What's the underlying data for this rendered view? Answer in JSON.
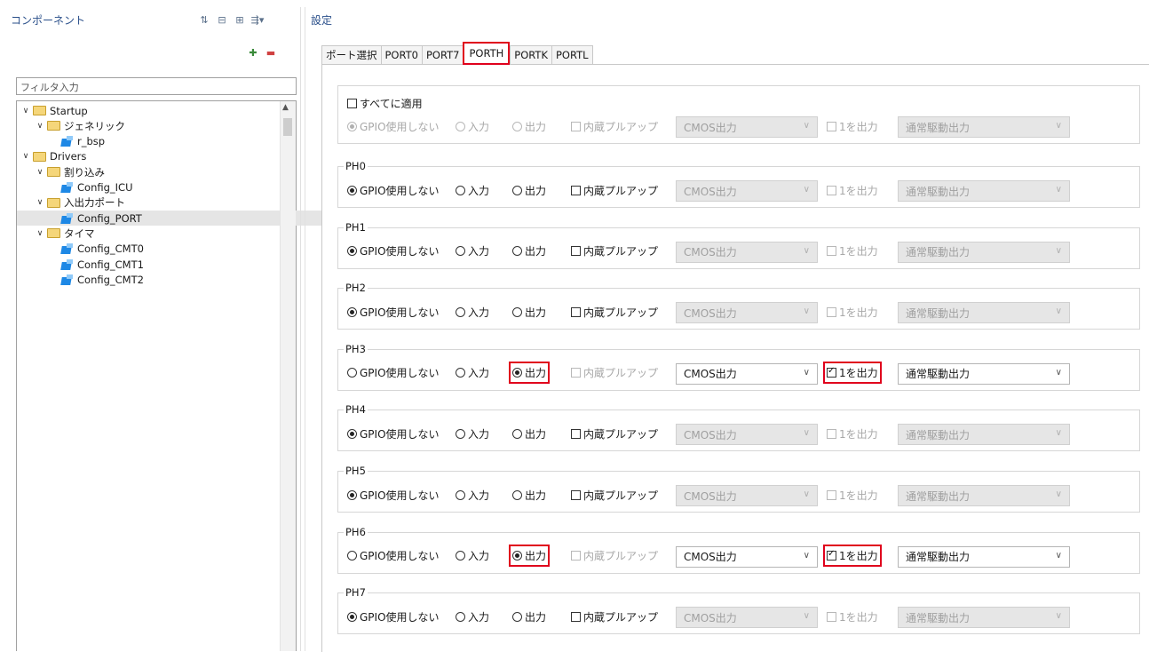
{
  "left_panel": {
    "title": "コンポーネント",
    "filter_placeholder": "フィルタ入力",
    "tree": [
      {
        "label": "Startup",
        "kind": "folder",
        "level": 0
      },
      {
        "label": "ジェネリック",
        "kind": "folder",
        "level": 1
      },
      {
        "label": "r_bsp",
        "kind": "component",
        "level": 2
      },
      {
        "label": "Drivers",
        "kind": "folder",
        "level": 0
      },
      {
        "label": "割り込み",
        "kind": "folder",
        "level": 1
      },
      {
        "label": "Config_ICU",
        "kind": "component",
        "level": 2
      },
      {
        "label": "入出力ポート",
        "kind": "folder",
        "level": 1
      },
      {
        "label": "Config_PORT",
        "kind": "component",
        "level": 2,
        "selected": true
      },
      {
        "label": "タイマ",
        "kind": "folder",
        "level": 1
      },
      {
        "label": "Config_CMT0",
        "kind": "component",
        "level": 2
      },
      {
        "label": "Config_CMT1",
        "kind": "component",
        "level": 2
      },
      {
        "label": "Config_CMT2",
        "kind": "component",
        "level": 2
      }
    ],
    "icons": [
      "sort-az-icon",
      "collapse-all-icon",
      "expand-all-icon",
      "view-menu-icon",
      "add-component-icon",
      "remove-component-icon"
    ]
  },
  "settings": {
    "title": "設定",
    "tabs": [
      "ポート選択",
      "PORT0",
      "PORT7",
      "PORTH",
      "PORTK",
      "PORTL"
    ],
    "active_tab": "PORTH",
    "apply_all": {
      "label": "すべてに適用",
      "checked": false,
      "gpio_label": "GPIO使用しない",
      "input_label": "入力",
      "output_label": "出力",
      "pullup_label": "内蔵プルアップ",
      "cmos_value": "CMOS出力",
      "out1_label": "1を出力",
      "drive_value": "通常駆動出力"
    },
    "pins": [
      {
        "name": "PH0",
        "mode": "gpio",
        "gpio_label": "GPIO使用しない",
        "input_label": "入力",
        "output_label": "出力",
        "pullup_label": "内蔵プルアップ",
        "cmos_value": "CMOS出力",
        "out1_label": "1を出力",
        "out1_checked": false,
        "drive_value": "通常駆動出力"
      },
      {
        "name": "PH1",
        "mode": "gpio",
        "gpio_label": "GPIO使用しない",
        "input_label": "入力",
        "output_label": "出力",
        "pullup_label": "内蔵プルアップ",
        "cmos_value": "CMOS出力",
        "out1_label": "1を出力",
        "out1_checked": false,
        "drive_value": "通常駆動出力"
      },
      {
        "name": "PH2",
        "mode": "gpio",
        "gpio_label": "GPIO使用しない",
        "input_label": "入力",
        "output_label": "出力",
        "pullup_label": "内蔵プルアップ",
        "cmos_value": "CMOS出力",
        "out1_label": "1を出力",
        "out1_checked": false,
        "drive_value": "通常駆動出力"
      },
      {
        "name": "PH3",
        "mode": "output",
        "gpio_label": "GPIO使用しない",
        "input_label": "入力",
        "output_label": "出力",
        "pullup_label": "内蔵プルアップ",
        "cmos_value": "CMOS出力",
        "out1_label": "1を出力",
        "out1_checked": true,
        "drive_value": "通常駆動出力"
      },
      {
        "name": "PH4",
        "mode": "gpio",
        "gpio_label": "GPIO使用しない",
        "input_label": "入力",
        "output_label": "出力",
        "pullup_label": "内蔵プルアップ",
        "cmos_value": "CMOS出力",
        "out1_label": "1を出力",
        "out1_checked": false,
        "drive_value": "通常駆動出力"
      },
      {
        "name": "PH5",
        "mode": "gpio",
        "gpio_label": "GPIO使用しない",
        "input_label": "入力",
        "output_label": "出力",
        "pullup_label": "内蔵プルアップ",
        "cmos_value": "CMOS出力",
        "out1_label": "1を出力",
        "out1_checked": false,
        "drive_value": "通常駆動出力"
      },
      {
        "name": "PH6",
        "mode": "output",
        "gpio_label": "GPIO使用しない",
        "input_label": "入力",
        "output_label": "出力",
        "pullup_label": "内蔵プルアップ",
        "cmos_value": "CMOS出力",
        "out1_label": "1を出力",
        "out1_checked": true,
        "drive_value": "通常駆動出力"
      },
      {
        "name": "PH7",
        "mode": "gpio",
        "gpio_label": "GPIO使用しない",
        "input_label": "入力",
        "output_label": "出力",
        "pullup_label": "内蔵プルアップ",
        "cmos_value": "CMOS出力",
        "out1_label": "1を出力",
        "out1_checked": false,
        "drive_value": "通常駆動出力"
      }
    ]
  },
  "colors": {
    "highlight": "#e0001c",
    "title_text": "#2a4f8a",
    "selected_row": "#e5e5e5"
  }
}
